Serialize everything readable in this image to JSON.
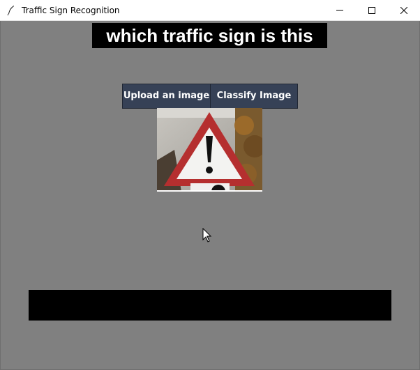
{
  "window": {
    "title": "Traffic Sign Recognition",
    "controls": [
      "minimize",
      "maximize",
      "close"
    ]
  },
  "heading": {
    "text": "which traffic sign is this"
  },
  "buttons": {
    "upload_label": "Upload an image",
    "classify_label": "Classify Image"
  },
  "image": {
    "description_icon": "warning-sign-image"
  },
  "result": {
    "text": ""
  },
  "colors": {
    "background": "#808080",
    "button": "#364156",
    "heading_bg": "#000000",
    "result_bg": "#000000"
  }
}
